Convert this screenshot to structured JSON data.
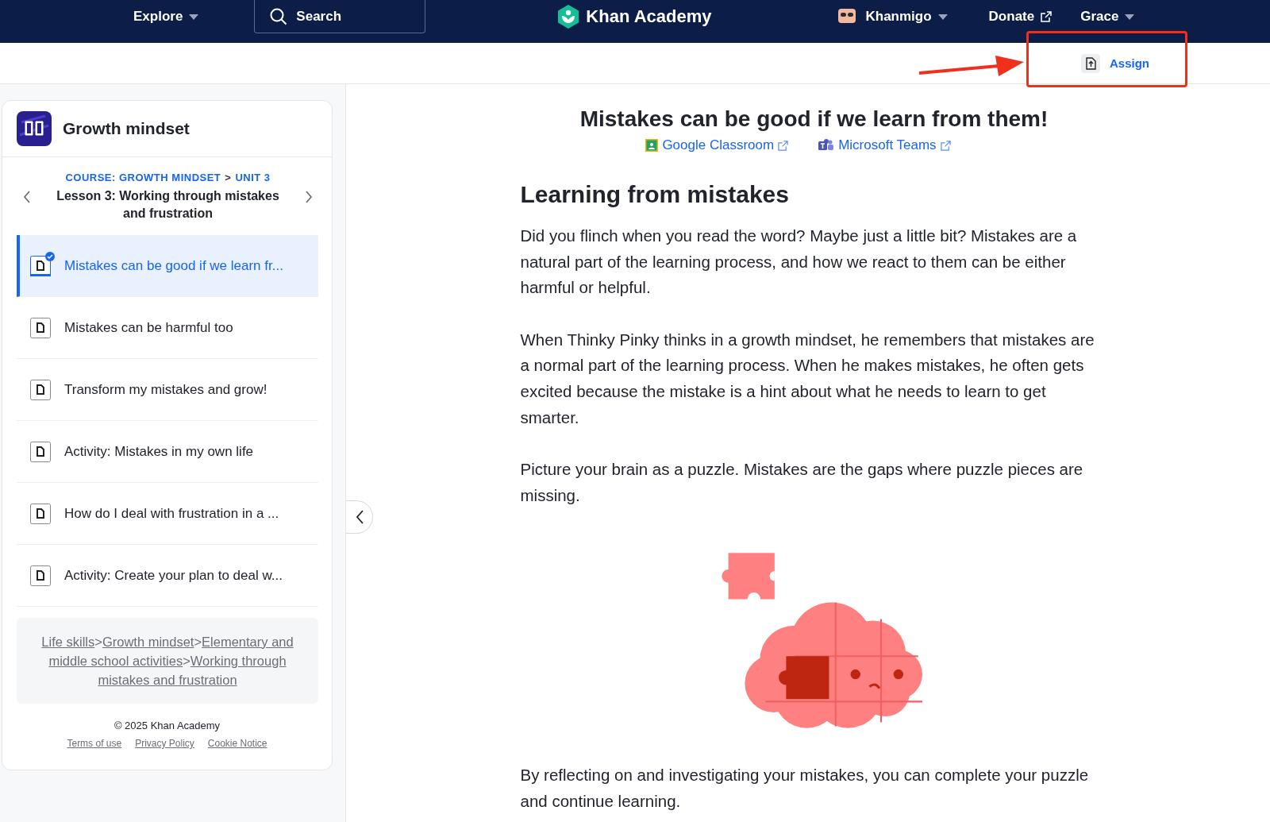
{
  "header": {
    "explore": "Explore",
    "search": {
      "placeholder": "Search"
    },
    "logo": "Khan Academy",
    "khanmigo": "Khanmigo",
    "donate": "Donate",
    "user": "Grace"
  },
  "assign_button": "Assign",
  "sidebar": {
    "course_title": "Growth mindset",
    "course_link": "COURSE: GROWTH MINDSET",
    "crumb_separator": ">",
    "unit_link": "UNIT 3",
    "lesson_title": "Lesson 3: Working through mistakes and frustration",
    "items": [
      {
        "title": "Mistakes can be good if we learn fr...",
        "selected": true,
        "completed": true
      },
      {
        "title": "Mistakes can be harmful too",
        "selected": false,
        "completed": false
      },
      {
        "title": "Transform my mistakes and grow!",
        "selected": false,
        "completed": false
      },
      {
        "title": "Activity: Mistakes in my own life",
        "selected": false,
        "completed": false
      },
      {
        "title": "How do I deal with frustration in a ...",
        "selected": false,
        "completed": false
      },
      {
        "title": "Activity: Create your plan to deal w...",
        "selected": false,
        "completed": false
      }
    ],
    "path_links": [
      "Life skills",
      "Growth mindset",
      "Elementary and middle school activities",
      "Working through mistakes and frustration"
    ],
    "path_separator": ">",
    "copyright": "© 2025 Khan Academy",
    "footer_links": [
      "Terms of use",
      "Privacy Policy",
      "Cookie Notice"
    ]
  },
  "article": {
    "title": "Mistakes can be good if we learn from them!",
    "share_links": [
      {
        "kind": "google",
        "label": "Google Classroom"
      },
      {
        "kind": "teams",
        "label": "Microsoft Teams"
      }
    ],
    "heading": "Learning from mistakes",
    "paragraphs": [
      "Did you flinch when you read the word? Maybe just a little bit? Mistakes are a natural part of the learning process, and how we react to them can be either harmful or helpful.",
      "When Thinky Pinky thinks in a growth mindset, he remembers that mistakes are a normal part of the learning process. When he makes mistakes, he often gets excited because the mistake is a hint about what he needs to learn to get smarter.",
      "Picture your brain as a puzzle. Mistakes are the gaps where puzzle pieces are missing."
    ],
    "closing": "By reflecting on and investigating your mistakes, you can complete your puzzle and continue learning."
  }
}
